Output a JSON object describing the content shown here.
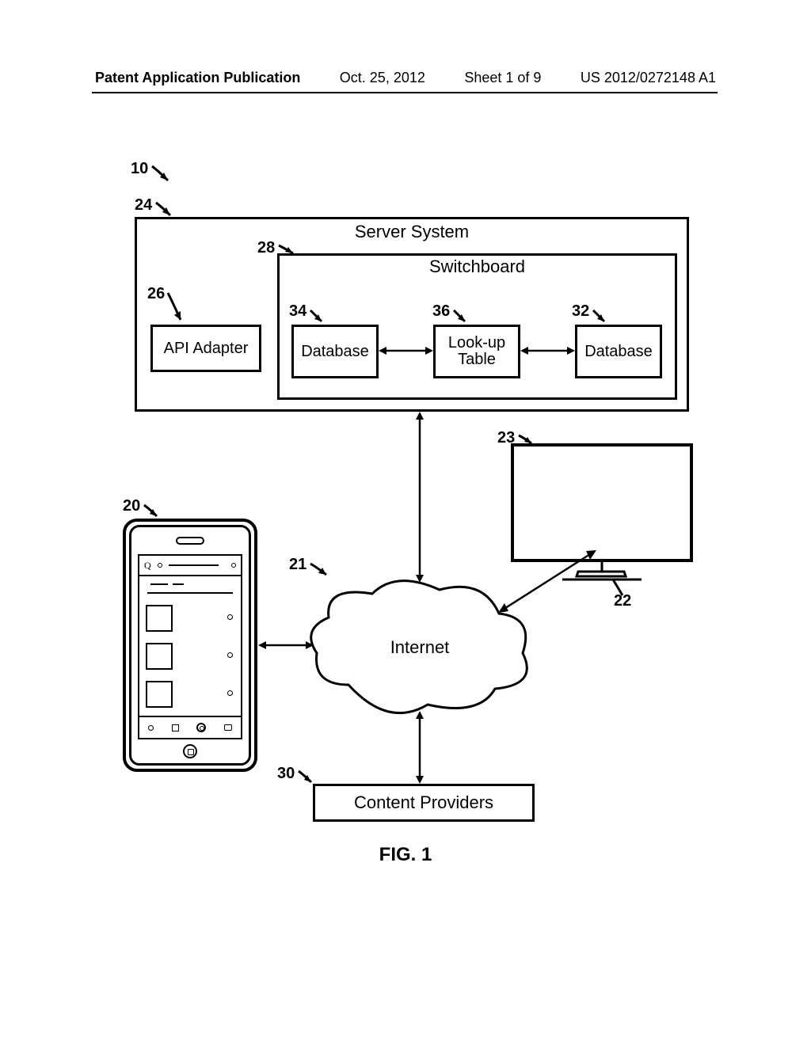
{
  "header": {
    "publication_type": "Patent Application Publication",
    "date": "Oct. 25, 2012",
    "sheet": "Sheet 1 of 9",
    "pub_number": "US 2012/0272148 A1"
  },
  "refs": {
    "r10": "10",
    "r24": "24",
    "r26": "26",
    "r28": "28",
    "r34": "34",
    "r36": "36",
    "r32": "32",
    "r20": "20",
    "r21": "21",
    "r22": "22",
    "r23": "23",
    "r30": "30"
  },
  "labels": {
    "server_system": "Server System",
    "switchboard": "Switchboard",
    "api_adapter": "API Adapter",
    "database": "Database",
    "lookup_table": "Look-up\nTable",
    "internet": "Internet",
    "content_providers": "Content Providers"
  },
  "figure": "FIG. 1"
}
